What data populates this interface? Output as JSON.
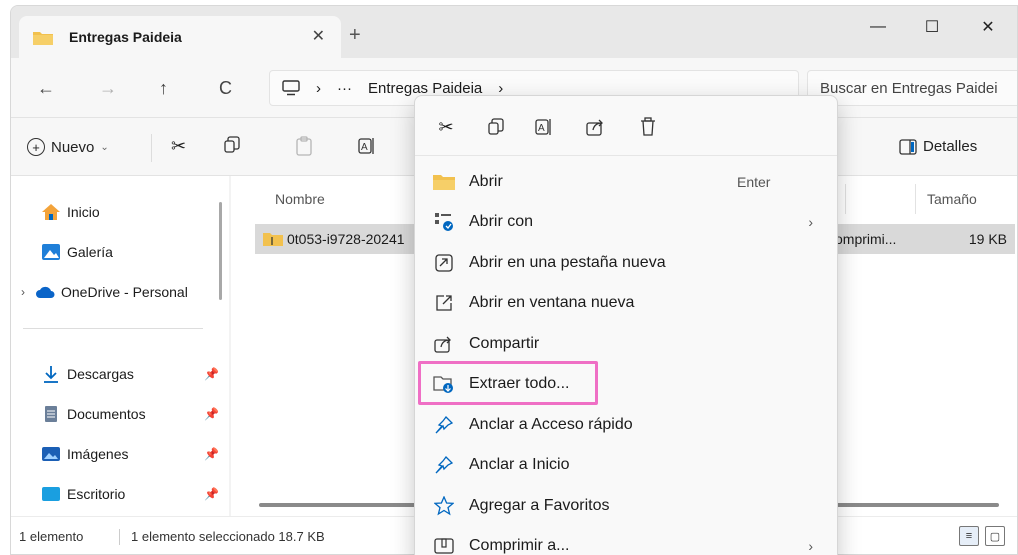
{
  "window": {
    "tab_title": "Entregas Paideia",
    "tab_close": "✕",
    "new_tab": "+",
    "minimize": "—",
    "maximize": "☐",
    "close": "✕"
  },
  "nav": {
    "back": "←",
    "forward": "→",
    "up": "↑",
    "refresh": "C",
    "breadcrumb_more": "···",
    "breadcrumb_current": "Entregas Paideia",
    "breadcrumb_sep": "›",
    "search_placeholder": "Buscar en Entregas Paidei"
  },
  "toolbar": {
    "new_label": "Nuevo",
    "details_label": "Detalles"
  },
  "sidebar": {
    "items": [
      {
        "label": "Inicio",
        "icon": "home-icon"
      },
      {
        "label": "Galería",
        "icon": "gallery-icon"
      },
      {
        "label": "OneDrive - Personal",
        "icon": "cloud-icon"
      },
      {
        "label": "Descargas",
        "icon": "download-icon",
        "pinned": true
      },
      {
        "label": "Documentos",
        "icon": "documents-icon",
        "pinned": true
      },
      {
        "label": "Imágenes",
        "icon": "pictures-icon",
        "pinned": true
      },
      {
        "label": "Escritorio",
        "icon": "desktop-icon",
        "pinned": true
      }
    ]
  },
  "content": {
    "columns": {
      "name": "Nombre",
      "size": "Tamaño"
    },
    "file": {
      "name": "0t053-i9728-20241",
      "type": "omprimi...",
      "size": "19 KB"
    }
  },
  "status": {
    "count": "1 elemento",
    "selection": "1 elemento seleccionado  18.7 KB"
  },
  "context_menu": {
    "items": [
      {
        "label": "Abrir",
        "accel": "Enter",
        "icon": "folder-icon"
      },
      {
        "label": "Abrir con",
        "submenu": true,
        "icon": "open-with-icon"
      },
      {
        "label": "Abrir en una pestaña nueva",
        "icon": "new-tab-icon"
      },
      {
        "label": "Abrir en ventana nueva",
        "icon": "new-window-icon"
      },
      {
        "label": "Compartir",
        "icon": "share-icon"
      },
      {
        "label": "Extraer todo...",
        "icon": "extract-icon"
      },
      {
        "label": "Anclar a Acceso rápido",
        "icon": "pin-icon"
      },
      {
        "label": "Anclar a Inicio",
        "icon": "pin-icon"
      },
      {
        "label": "Agregar a Favoritos",
        "icon": "star-icon"
      },
      {
        "label": "Comprimir a...",
        "submenu": true,
        "icon": "compress-icon"
      }
    ]
  },
  "colors": {
    "highlight": "#ef6fc5",
    "accent": "#0067c0",
    "folder": "#f2c14e"
  }
}
